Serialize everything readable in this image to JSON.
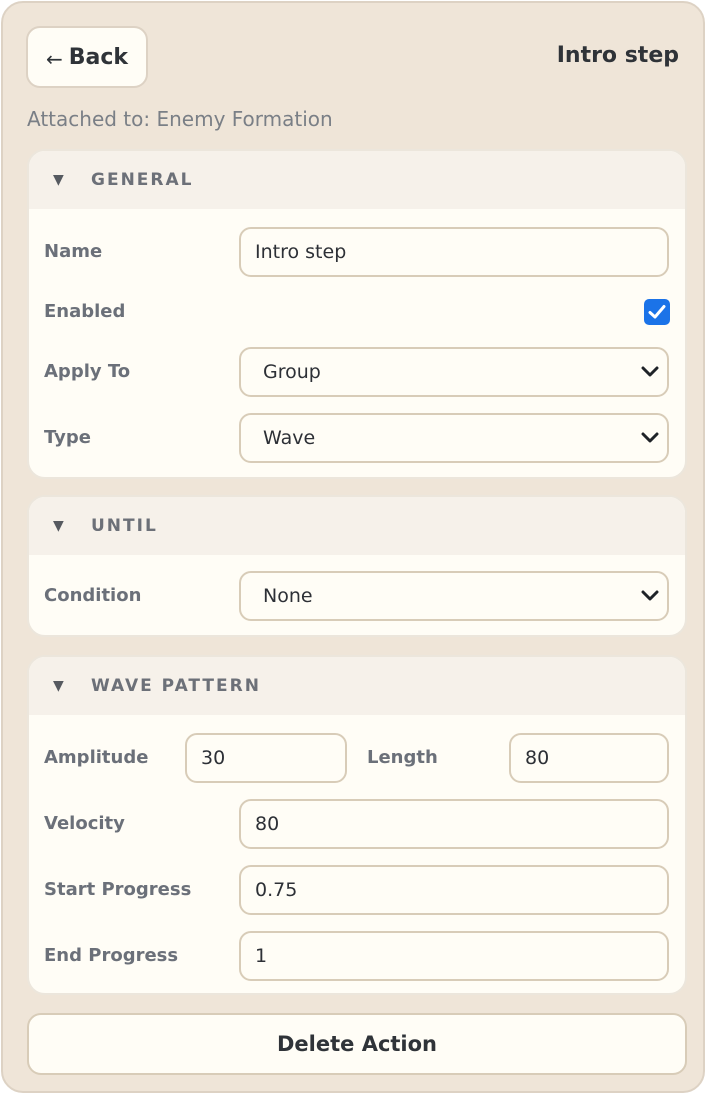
{
  "header": {
    "back_label": "Back",
    "back_arrow": "←",
    "title": "Intro step"
  },
  "attached": "Attached to: Enemy Formation",
  "general": {
    "title": "GENERAL",
    "caret": "▼",
    "name_label": "Name",
    "name_value": "Intro step",
    "enabled_label": "Enabled",
    "enabled_checked": true,
    "apply_label": "Apply To",
    "apply_value": "Group",
    "type_label": "Type",
    "type_value": "Wave"
  },
  "until": {
    "title": "UNTIL",
    "caret": "▼",
    "condition_label": "Condition",
    "condition_value": "None"
  },
  "wave": {
    "title": "WAVE PATTERN",
    "caret": "▼",
    "amplitude_label": "Amplitude",
    "amplitude_value": "30",
    "length_label": "Length",
    "length_value": "80",
    "velocity_label": "Velocity",
    "velocity_value": "80",
    "start_label": "Start Progress",
    "start_value": "0.75",
    "end_label": "End Progress",
    "end_value": "1"
  },
  "delete_label": "Delete Action",
  "colors": {
    "panel": "#efe5d8",
    "accent_checkbox": "#1b73e8",
    "field_border": "#d8ccb8"
  }
}
